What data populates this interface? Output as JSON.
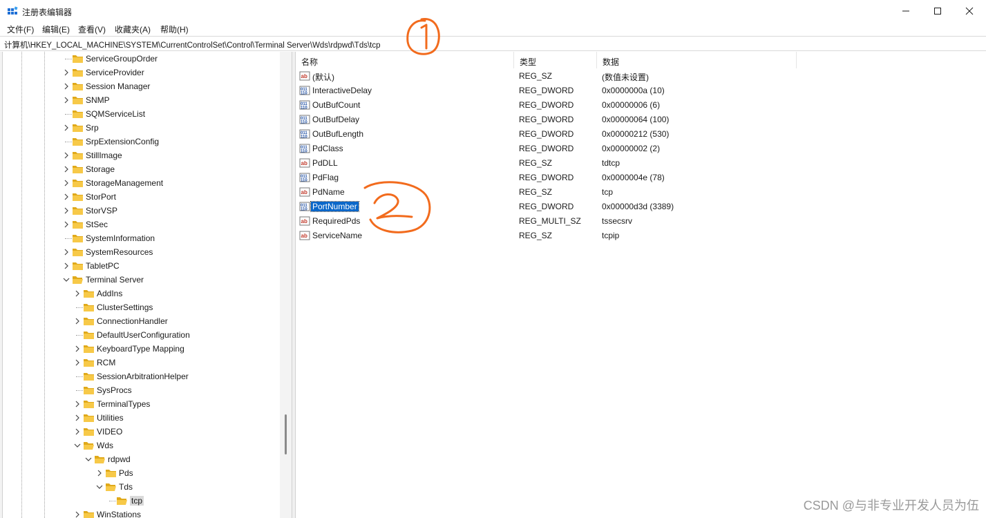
{
  "window": {
    "title": "注册表编辑器",
    "icon": "regedit-icon",
    "buttons": [
      "minimize-icon",
      "maximize-icon",
      "close-icon"
    ]
  },
  "menu": [
    "文件(F)",
    "编辑(E)",
    "查看(V)",
    "收藏夹(A)",
    "帮助(H)"
  ],
  "address": "计算机\\HKEY_LOCAL_MACHINE\\SYSTEM\\CurrentControlSet\\Control\\Terminal Server\\Wds\\rdpwd\\Tds\\tcp",
  "tree": {
    "items": [
      {
        "label": "ServiceGroupOrder",
        "expander": "none",
        "level": 0
      },
      {
        "label": "ServiceProvider",
        "expander": "collapsed",
        "level": 0
      },
      {
        "label": "Session Manager",
        "expander": "collapsed",
        "level": 0
      },
      {
        "label": "SNMP",
        "expander": "collapsed",
        "level": 0
      },
      {
        "label": "SQMServiceList",
        "expander": "none",
        "level": 0
      },
      {
        "label": "Srp",
        "expander": "collapsed",
        "level": 0
      },
      {
        "label": "SrpExtensionConfig",
        "expander": "none",
        "level": 0
      },
      {
        "label": "StillImage",
        "expander": "collapsed",
        "level": 0
      },
      {
        "label": "Storage",
        "expander": "collapsed",
        "level": 0
      },
      {
        "label": "StorageManagement",
        "expander": "collapsed",
        "level": 0
      },
      {
        "label": "StorPort",
        "expander": "collapsed",
        "level": 0
      },
      {
        "label": "StorVSP",
        "expander": "collapsed",
        "level": 0
      },
      {
        "label": "StSec",
        "expander": "collapsed",
        "level": 0
      },
      {
        "label": "SystemInformation",
        "expander": "none",
        "level": 0
      },
      {
        "label": "SystemResources",
        "expander": "collapsed",
        "level": 0
      },
      {
        "label": "TabletPC",
        "expander": "collapsed",
        "level": 0
      },
      {
        "label": "Terminal Server",
        "expander": "expanded",
        "level": 0
      },
      {
        "label": "AddIns",
        "expander": "collapsed",
        "level": 1
      },
      {
        "label": "ClusterSettings",
        "expander": "none",
        "level": 1
      },
      {
        "label": "ConnectionHandler",
        "expander": "collapsed",
        "level": 1
      },
      {
        "label": "DefaultUserConfiguration",
        "expander": "none",
        "level": 1
      },
      {
        "label": "KeyboardType Mapping",
        "expander": "collapsed",
        "level": 1
      },
      {
        "label": "RCM",
        "expander": "collapsed",
        "level": 1
      },
      {
        "label": "SessionArbitrationHelper",
        "expander": "none",
        "level": 1
      },
      {
        "label": "SysProcs",
        "expander": "none",
        "level": 1
      },
      {
        "label": "TerminalTypes",
        "expander": "collapsed",
        "level": 1
      },
      {
        "label": "Utilities",
        "expander": "collapsed",
        "level": 1
      },
      {
        "label": "VIDEO",
        "expander": "collapsed",
        "level": 1
      },
      {
        "label": "Wds",
        "expander": "expanded",
        "level": 1
      },
      {
        "label": "rdpwd",
        "expander": "expanded",
        "level": 2
      },
      {
        "label": "Pds",
        "expander": "collapsed",
        "level": 3
      },
      {
        "label": "Tds",
        "expander": "expanded",
        "level": 3
      },
      {
        "label": "tcp",
        "expander": "none",
        "level": 4,
        "selected": true
      },
      {
        "label": "WinStations",
        "expander": "collapsed",
        "level": 1
      }
    ]
  },
  "list": {
    "columns": [
      "名称",
      "类型",
      "数据"
    ],
    "rows": [
      {
        "icon": "string-value-icon",
        "name": "(默认)",
        "type": "REG_SZ",
        "data": "(数值未设置)"
      },
      {
        "icon": "binary-value-icon",
        "name": "InteractiveDelay",
        "type": "REG_DWORD",
        "data": "0x0000000a (10)"
      },
      {
        "icon": "binary-value-icon",
        "name": "OutBufCount",
        "type": "REG_DWORD",
        "data": "0x00000006 (6)"
      },
      {
        "icon": "binary-value-icon",
        "name": "OutBufDelay",
        "type": "REG_DWORD",
        "data": "0x00000064 (100)"
      },
      {
        "icon": "binary-value-icon",
        "name": "OutBufLength",
        "type": "REG_DWORD",
        "data": "0x00000212 (530)"
      },
      {
        "icon": "binary-value-icon",
        "name": "PdClass",
        "type": "REG_DWORD",
        "data": "0x00000002 (2)"
      },
      {
        "icon": "string-value-icon",
        "name": "PdDLL",
        "type": "REG_SZ",
        "data": "tdtcp"
      },
      {
        "icon": "binary-value-icon",
        "name": "PdFlag",
        "type": "REG_DWORD",
        "data": "0x0000004e (78)"
      },
      {
        "icon": "string-value-icon",
        "name": "PdName",
        "type": "REG_SZ",
        "data": "tcp"
      },
      {
        "icon": "binary-value-icon",
        "name": "PortNumber",
        "type": "REG_DWORD",
        "data": "0x00000d3d (3389)",
        "selected": true
      },
      {
        "icon": "string-value-icon",
        "name": "RequiredPds",
        "type": "REG_MULTI_SZ",
        "data": "tssecsrv"
      },
      {
        "icon": "string-value-icon",
        "name": "ServiceName",
        "type": "REG_SZ",
        "data": "tcpip"
      }
    ]
  },
  "annotations": {
    "color": "#f26b1d",
    "marks": [
      "1",
      "2"
    ]
  },
  "watermark": "CSDN @与非专业开发人员为伍"
}
